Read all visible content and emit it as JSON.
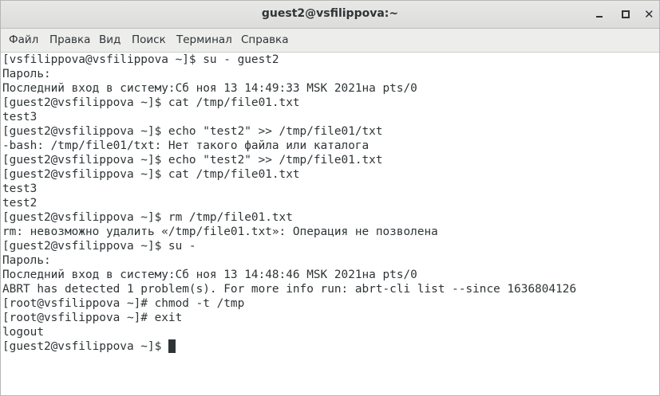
{
  "window": {
    "title": "guest2@vsfilippova:~"
  },
  "menu": {
    "items": [
      "Файл",
      "Правка",
      "Вид",
      "Поиск",
      "Терминал",
      "Справка"
    ]
  },
  "terminal": {
    "lines": [
      "[vsfilippova@vsfilippova ~]$ su - guest2",
      "Пароль:",
      "Последний вход в систему:Сб ноя 13 14:49:33 MSK 2021на pts/0",
      "[guest2@vsfilippova ~]$ cat /tmp/file01.txt",
      "test3",
      "[guest2@vsfilippova ~]$ echo \"test2\" >> /tmp/file01/txt",
      "-bash: /tmp/file01/txt: Нет такого файла или каталога",
      "[guest2@vsfilippova ~]$ echo \"test2\" >> /tmp/file01.txt",
      "[guest2@vsfilippova ~]$ cat /tmp/file01.txt",
      "test3",
      "test2",
      "[guest2@vsfilippova ~]$ rm /tmp/file01.txt",
      "rm: невозможно удалить «/tmp/file01.txt»: Операция не позволена",
      "[guest2@vsfilippova ~]$ su -",
      "Пароль:",
      "Последний вход в систему:Сб ноя 13 14:48:46 MSK 2021на pts/0",
      "ABRT has detected 1 problem(s). For more info run: abrt-cli list --since 1636804126",
      "[root@vsfilippova ~]# chmod -t /tmp",
      "[root@vsfilippova ~]# exit",
      "logout"
    ],
    "prompt": "[guest2@vsfilippova ~]$ "
  }
}
